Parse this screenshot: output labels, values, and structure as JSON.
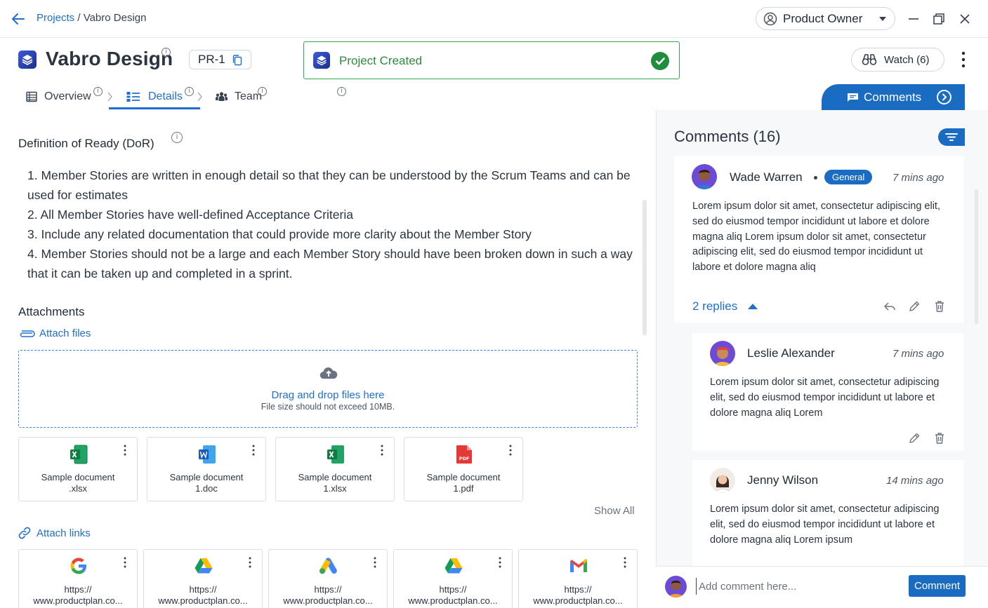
{
  "topbar": {
    "breadcrumb_link": "Projects",
    "breadcrumb_sep": " / ",
    "breadcrumb_current": "Vabro Design",
    "role": "Product Owner"
  },
  "project": {
    "title": "Vabro Design",
    "key": "PR-1",
    "watch_label": "Watch (6)"
  },
  "toast": {
    "message": "Project Created"
  },
  "tabs": [
    {
      "label": "Overview",
      "active": false
    },
    {
      "label": "Details",
      "active": true
    },
    {
      "label": "Team",
      "active": false
    }
  ],
  "comments_tab": {
    "label": "Comments"
  },
  "details": {
    "dor_heading": "Definition of Ready (DoR)",
    "dor_items": [
      "1. Member Stories are written in enough detail so that they can be understood by the Scrum Teams and can be used for estimates",
      "2. All Member Stories have well-defined Acceptance Criteria",
      "3. Include any related documentation that could provide more clarity about the Member Story",
      "4. Member Stories should not be a large and each Member Story should have been broken down in such a way that it can be taken up and completed in a sprint."
    ],
    "attachments_heading": "Attachments",
    "attach_files_label": "Attach files",
    "dropzone_primary": "Drag and drop files here",
    "dropzone_secondary": "File size should not exceed 10MB.",
    "files": [
      {
        "line1": "Sample document",
        "line2": ".xlsx",
        "type": "excel"
      },
      {
        "line1": "Sample document",
        "line2": "1.doc",
        "type": "word"
      },
      {
        "line1": "Sample document",
        "line2": "1.xlsx",
        "type": "excel"
      },
      {
        "line1": "Sample document",
        "line2": "1.pdf",
        "type": "pdf"
      }
    ],
    "show_all": "Show All",
    "attach_links_label": "Attach links",
    "links": [
      {
        "line1": "https://",
        "line2": "www.productplan.co...",
        "icon": "google-icon"
      },
      {
        "line1": "https://",
        "line2": "www.productplan.co...",
        "icon": "google-drive-icon"
      },
      {
        "line1": "https://",
        "line2": "www.productplan.co...",
        "icon": "google-ads-icon"
      },
      {
        "line1": "https://",
        "line2": "www.productplan.co...",
        "icon": "google-drive-icon"
      },
      {
        "line1": "https://",
        "line2": "www.productplan.co...",
        "icon": "gmail-icon"
      }
    ]
  },
  "comments_panel": {
    "heading": "Comments (16)",
    "comments": [
      {
        "author": "Wade Warren",
        "badge": "General",
        "time": "7 mins ago",
        "body": "Lorem ipsum dolor sit amet, consectetur adipiscing elit, sed do eiusmod tempor incididunt ut labore et dolore magna aliq Lorem ipsum dolor sit amet, consectetur adipiscing elit, sed do eiusmod tempor incididunt ut labore et dolore magna aliq",
        "replies_label": "2 replies"
      }
    ],
    "replies": [
      {
        "author": "Leslie Alexander",
        "time": "7 mins ago",
        "body": "Lorem ipsum dolor sit amet, consectetur adipiscing elit, sed do eiusmod tempor incididunt ut labore et dolore magna aliq Lorem"
      },
      {
        "author": "Jenny Wilson",
        "time": "14 mins ago",
        "body": "Lorem ipsum dolor sit amet, consectetur adipiscing elit, sed do eiusmod tempor incididunt ut labore et dolore magna aliq Lorem ipsum"
      }
    ],
    "composer_placeholder": "Add comment here...",
    "composer_button": "Comment"
  },
  "colors": {
    "accent": "#1a6cc2",
    "link": "#1f6fd1",
    "success": "#1e8e3e"
  }
}
